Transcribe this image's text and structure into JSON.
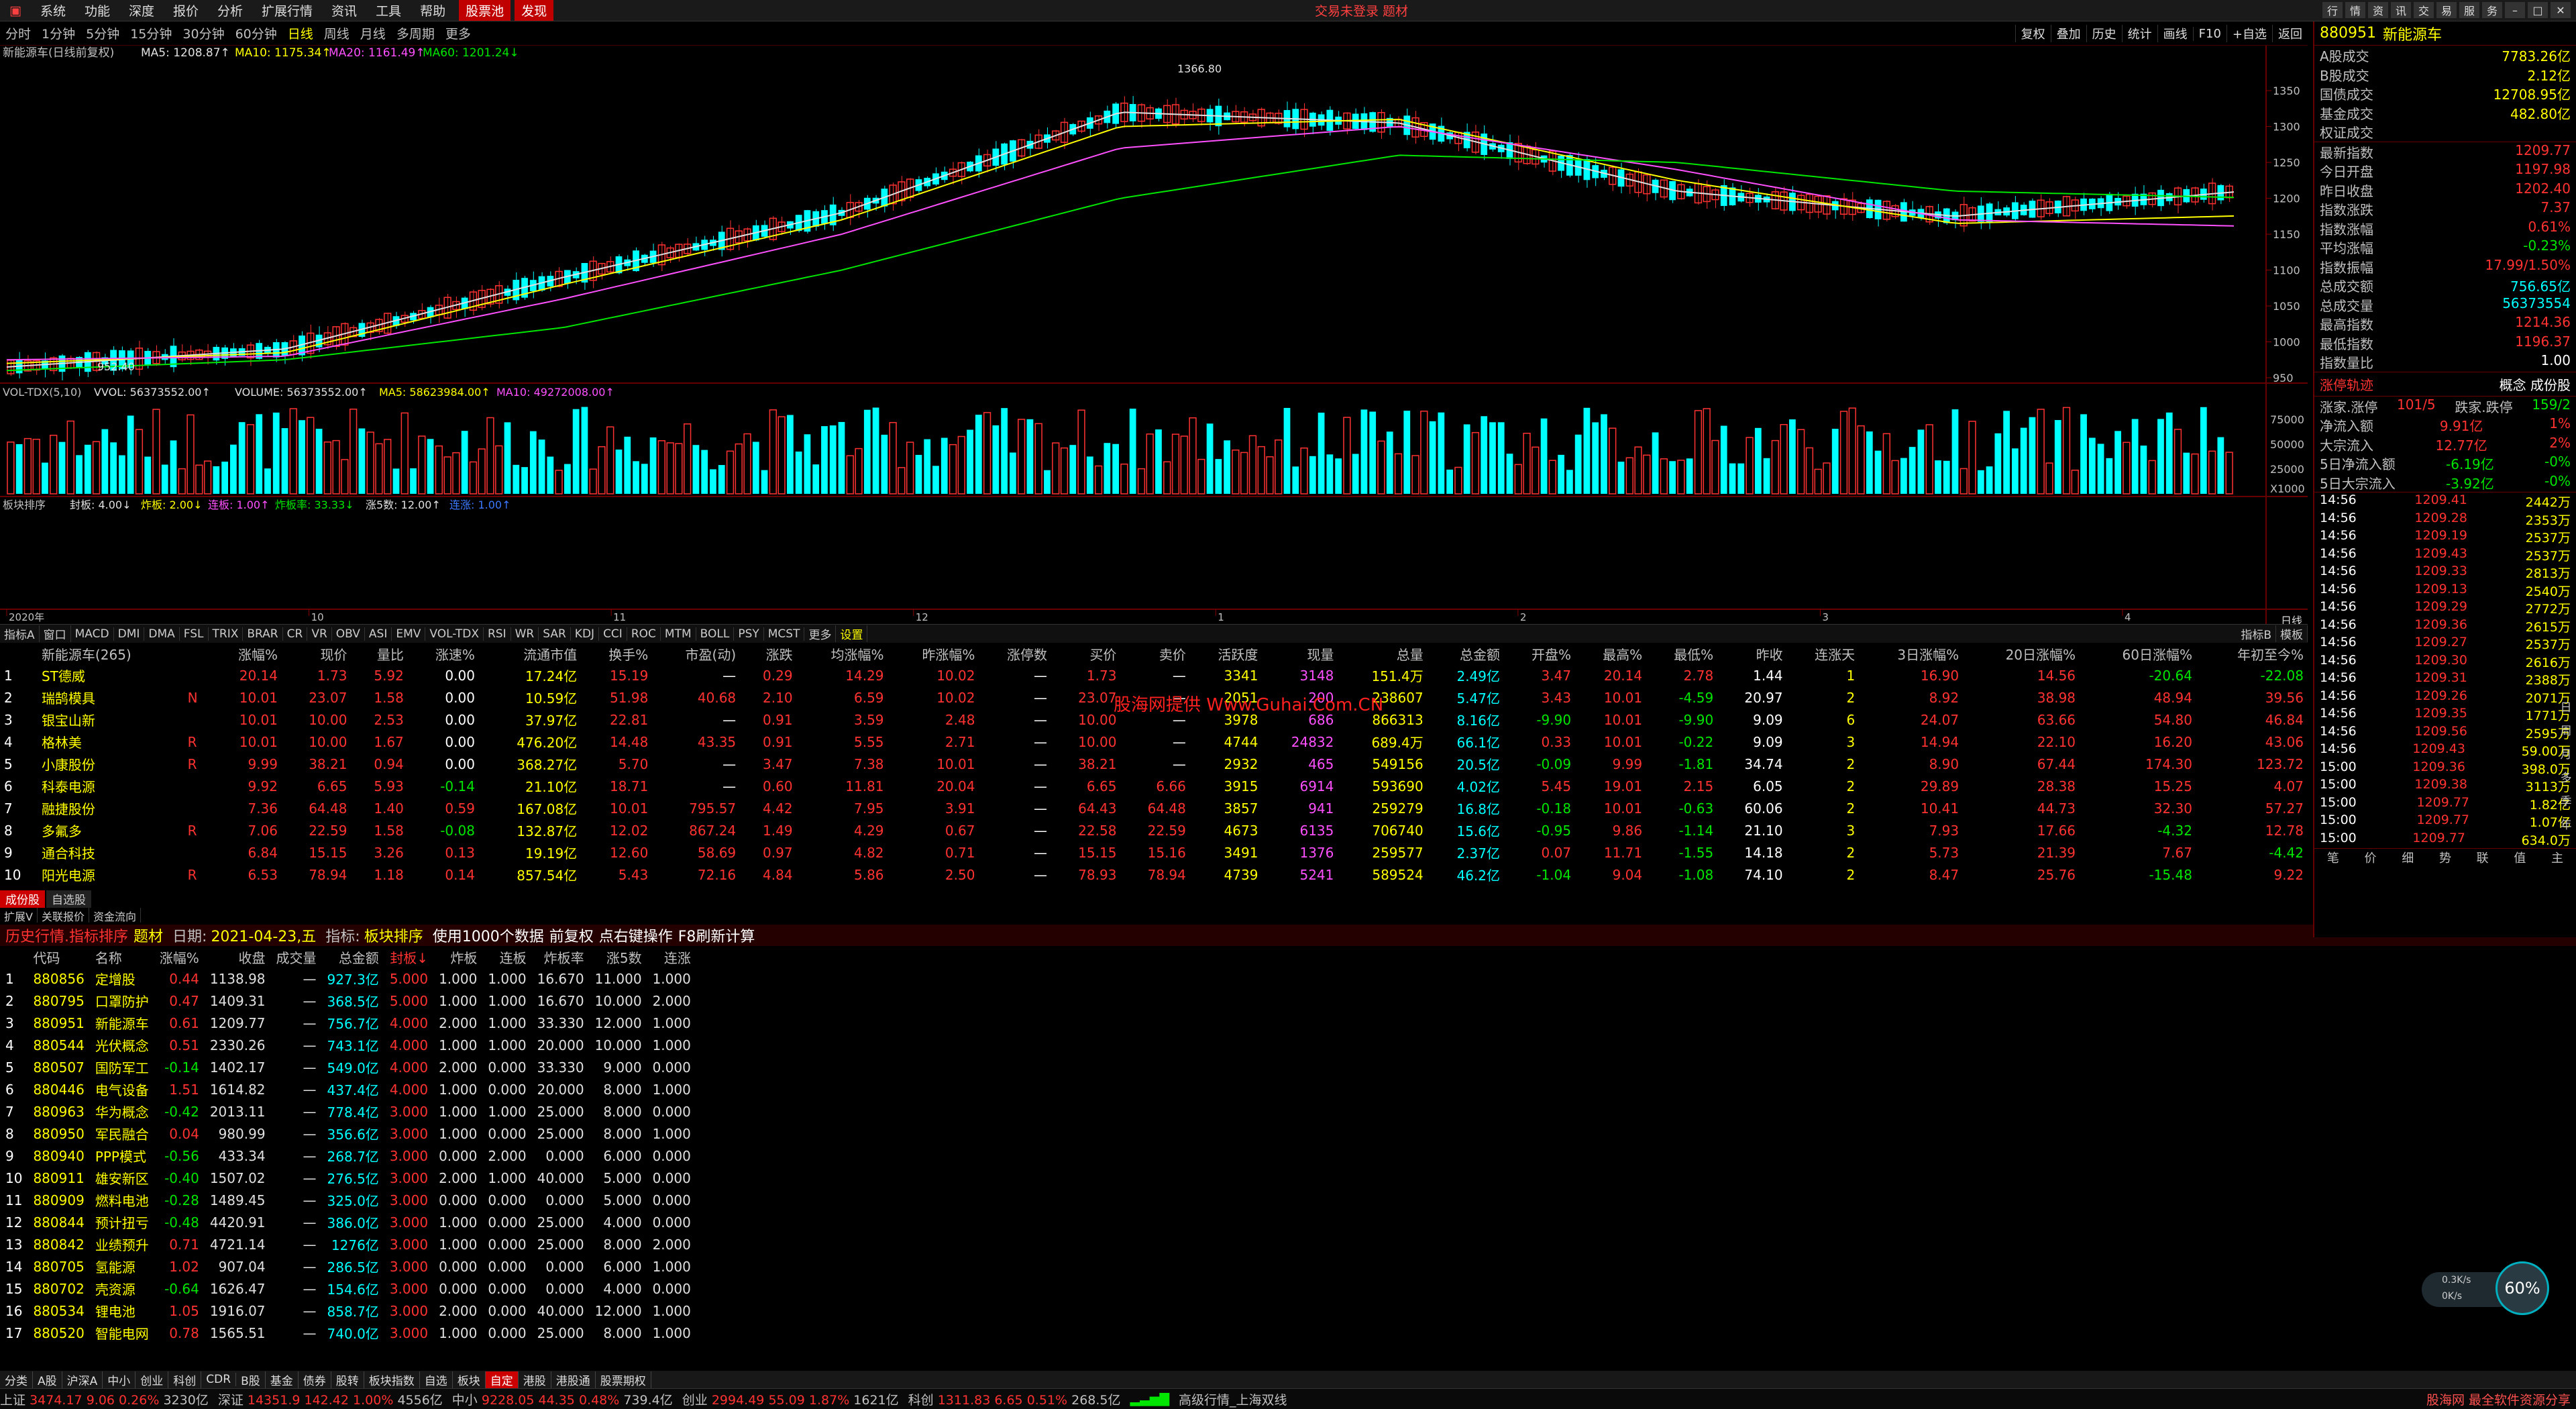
{
  "menu": {
    "items": [
      "系统",
      "功能",
      "深度",
      "报价",
      "分析",
      "扩展行情",
      "资讯",
      "工具",
      "帮助"
    ],
    "highlight": [
      "股票池",
      "发现"
    ],
    "center_title": "交易未登录  题材",
    "window_buttons": [
      "行",
      "情",
      "资",
      "讯",
      "交",
      "易",
      "服",
      "务"
    ]
  },
  "periods": [
    "分时",
    "1分钟",
    "5分钟",
    "15分钟",
    "30分钟",
    "60分钟",
    "日线",
    "周线",
    "月线",
    "多周期",
    "更多"
  ],
  "active_period": "日线",
  "chart_tools": [
    "复权",
    "叠加",
    "历史",
    "统计",
    "画线",
    "F10",
    "+自选",
    "返回"
  ],
  "main_legend": {
    "name": "新能源车(日线前复权)",
    "ma5": "MA5: 1208.87↑",
    "ma10": "MA10: 1175.34↑",
    "ma20": "MA20: 1161.49↑",
    "ma60": "MA60: 1201.24↓"
  },
  "vol_legend": {
    "name": "VOL-TDX(5,10)",
    "vvol": "VVOL: 56373552.00↑",
    "volume": "VOLUME: 56373552.00↑",
    "ma5": "MA5: 58623984.00↑",
    "ma10": "MA10: 49272008.00↑"
  },
  "board_legend": {
    "name": "板块排序",
    "fb": "封板: 4.00↓",
    "zb": "炸板: 2.00↓",
    "lb": "连板: 1.00↑",
    "zbl": "炸板率: 33.33↓",
    "z5": "涨5数: 12.00↑",
    "lz": "连涨: 1.00↑"
  },
  "price_axis": [
    "1350",
    "1300",
    "1250",
    "1200",
    "1150",
    "1100",
    "1050",
    "1000",
    "950"
  ],
  "vol_axis": [
    "75000",
    "50000",
    "25000",
    "X1000"
  ],
  "annot_high": "1366.80",
  "annot_low": "952.40",
  "date_axis": [
    "2020年",
    "10",
    "11",
    "12",
    "1",
    "2",
    "3",
    "4"
  ],
  "indicator_tabs": [
    "指标A",
    "窗口",
    "MACD",
    "DMI",
    "DMA",
    "FSL",
    "TRIX",
    "BRAR",
    "CR",
    "VR",
    "OBV",
    "ASI",
    "EMV",
    "VOL-TDX",
    "RSI",
    "WR",
    "SAR",
    "KDJ",
    "CCI",
    "ROC",
    "MTM",
    "BOLL",
    "PSY",
    "MCST",
    "更多",
    "设置"
  ],
  "indicator_right": [
    "指标B",
    "模板"
  ],
  "chart_data": {
    "type": "line",
    "title": "新能源车(日线前复权)",
    "xlabel": "",
    "ylabel": "",
    "ylim": [
      950,
      1380
    ],
    "x": [
      "2020年",
      "10",
      "11",
      "12",
      "1",
      "2",
      "3",
      "4"
    ],
    "series": [
      {
        "name": "MA5",
        "values": [
          965,
          990,
          1090,
          1180,
          1320,
          1305,
          1210,
          1175,
          1208.87
        ]
      },
      {
        "name": "MA10",
        "values": [
          970,
          985,
          1080,
          1170,
          1300,
          1310,
          1225,
          1165,
          1175.34
        ]
      },
      {
        "name": "MA20",
        "values": [
          975,
          980,
          1060,
          1150,
          1270,
          1300,
          1240,
          1170,
          1161.49
        ]
      },
      {
        "name": "MA60",
        "values": [
          960,
          975,
          1020,
          1100,
          1200,
          1260,
          1250,
          1210,
          1201.24
        ]
      }
    ]
  },
  "table1": {
    "title": "新能源车(265)",
    "columns": [
      "",
      "新能源车(265)",
      "",
      "涨幅%",
      "现价",
      "量比",
      "涨速%",
      "流通市值",
      "换手%",
      "市盈(动)",
      "涨跌",
      "均涨幅%",
      "昨涨幅%",
      "涨停数",
      "买价",
      "卖价",
      "活跃度",
      "现量",
      "总量",
      "总金额",
      "开盘%",
      "最高%",
      "最低%",
      "昨收",
      "连涨天",
      "3日涨幅%",
      "20日涨幅%",
      "60日涨幅%",
      "年初至今%"
    ],
    "rows": [
      [
        "1",
        "ST德威",
        "",
        "20.14",
        "1.73",
        "5.92",
        "0.00",
        "17.24亿",
        "15.19",
        "—",
        "0.29",
        "14.29",
        "10.02",
        "—",
        "1.73",
        "—",
        "3341",
        "3148",
        "151.4万",
        "2.49亿",
        "3.47",
        "20.14",
        "2.78",
        "1.44",
        "1",
        "16.90",
        "14.56",
        "-20.64",
        "-22.08"
      ],
      [
        "2",
        "瑞鹄模具",
        "N",
        "10.01",
        "23.07",
        "1.58",
        "0.00",
        "10.59亿",
        "51.98",
        "40.68",
        "2.10",
        "6.59",
        "10.02",
        "—",
        "23.07",
        "—",
        "2051",
        "200",
        "238607",
        "5.47亿",
        "3.43",
        "10.01",
        "-4.59",
        "20.97",
        "2",
        "8.92",
        "38.98",
        "48.94",
        "39.56"
      ],
      [
        "3",
        "银宝山新",
        "",
        "10.01",
        "10.00",
        "2.53",
        "0.00",
        "37.97亿",
        "22.81",
        "—",
        "0.91",
        "3.59",
        "2.48",
        "—",
        "10.00",
        "—",
        "3978",
        "686",
        "866313",
        "8.16亿",
        "-9.90",
        "10.01",
        "-9.90",
        "9.09",
        "6",
        "24.07",
        "63.66",
        "54.80",
        "46.84"
      ],
      [
        "4",
        "格林美",
        "R",
        "10.01",
        "10.00",
        "1.67",
        "0.00",
        "476.20亿",
        "14.48",
        "43.35",
        "0.91",
        "5.55",
        "2.71",
        "—",
        "10.00",
        "—",
        "4744",
        "24832",
        "689.4万",
        "66.1亿",
        "0.33",
        "10.01",
        "-0.22",
        "9.09",
        "3",
        "14.94",
        "22.10",
        "16.20",
        "43.06"
      ],
      [
        "5",
        "小康股份",
        "R",
        "9.99",
        "38.21",
        "0.94",
        "0.00",
        "368.27亿",
        "5.70",
        "—",
        "3.47",
        "7.38",
        "10.01",
        "—",
        "38.21",
        "—",
        "2932",
        "465",
        "549156",
        "20.5亿",
        "-0.09",
        "9.99",
        "-1.81",
        "34.74",
        "2",
        "8.90",
        "67.44",
        "174.30",
        "123.72"
      ],
      [
        "6",
        "科泰电源",
        "",
        "9.92",
        "6.65",
        "5.93",
        "-0.14",
        "21.10亿",
        "18.71",
        "—",
        "0.60",
        "11.81",
        "20.04",
        "—",
        "6.65",
        "6.66",
        "3915",
        "6914",
        "593690",
        "4.02亿",
        "5.45",
        "19.01",
        "2.15",
        "6.05",
        "2",
        "29.89",
        "28.38",
        "15.25",
        "4.07"
      ],
      [
        "7",
        "融捷股份",
        "",
        "7.36",
        "64.48",
        "1.40",
        "0.59",
        "167.08亿",
        "10.01",
        "795.57",
        "4.42",
        "7.95",
        "3.91",
        "—",
        "64.43",
        "64.48",
        "3857",
        "941",
        "259279",
        "16.8亿",
        "-0.18",
        "10.01",
        "-0.63",
        "60.06",
        "2",
        "10.41",
        "44.73",
        "32.30",
        "57.27"
      ],
      [
        "8",
        "多氟多",
        "R",
        "7.06",
        "22.59",
        "1.58",
        "-0.08",
        "132.87亿",
        "12.02",
        "867.24",
        "1.49",
        "4.29",
        "0.67",
        "—",
        "22.58",
        "22.59",
        "4673",
        "6135",
        "706740",
        "15.6亿",
        "-0.95",
        "9.86",
        "-1.14",
        "21.10",
        "3",
        "7.93",
        "17.66",
        "-4.32",
        "12.78"
      ],
      [
        "9",
        "通合科技",
        "",
        "6.84",
        "15.15",
        "3.26",
        "0.13",
        "19.19亿",
        "12.60",
        "58.69",
        "0.97",
        "4.82",
        "0.71",
        "—",
        "15.15",
        "15.16",
        "3491",
        "1376",
        "259577",
        "2.37亿",
        "0.07",
        "11.71",
        "-1.55",
        "14.18",
        "2",
        "5.73",
        "21.39",
        "7.67",
        "-4.42"
      ],
      [
        "10",
        "阳光电源",
        "R",
        "6.53",
        "78.94",
        "1.18",
        "0.14",
        "857.54亿",
        "5.43",
        "72.16",
        "4.84",
        "5.86",
        "2.50",
        "—",
        "78.93",
        "78.94",
        "4739",
        "5241",
        "589524",
        "46.2亿",
        "-1.04",
        "9.04",
        "-1.08",
        "74.10",
        "2",
        "8.47",
        "25.76",
        "-15.48",
        "9.22"
      ]
    ]
  },
  "tabs1": [
    "成份股",
    "自选股"
  ],
  "subtabs": [
    "扩展V",
    "关联报价",
    "资金流向"
  ],
  "history": {
    "title": "历史行情.指标排序",
    "label_tc": "题材",
    "date_label": "日期:",
    "date": "2021-04-23,五",
    "ind_label": "指标:",
    "ind": "板块排序",
    "count": "使用1000个数据",
    "restore": "前复权",
    "hint": "点右键操作",
    "f8": "F8刷新计算",
    "columns": [
      "",
      "代码",
      "名称",
      "涨幅%",
      "收盘",
      "成交量",
      "总金额",
      "封板↓",
      "炸板",
      "连板",
      "炸板率",
      "涨5数",
      "连涨"
    ],
    "rows": [
      [
        "1",
        "880856",
        "定增股",
        "0.44",
        "1138.98",
        "—",
        "927.3亿",
        "5.000",
        "1.000",
        "1.000",
        "16.670",
        "11.000",
        "1.000"
      ],
      [
        "2",
        "880795",
        "口罩防护",
        "0.47",
        "1409.31",
        "—",
        "368.5亿",
        "5.000",
        "1.000",
        "1.000",
        "16.670",
        "10.000",
        "2.000"
      ],
      [
        "3",
        "880951",
        "新能源车",
        "0.61",
        "1209.77",
        "—",
        "756.7亿",
        "4.000",
        "2.000",
        "1.000",
        "33.330",
        "12.000",
        "1.000"
      ],
      [
        "4",
        "880544",
        "光伏概念",
        "0.51",
        "2330.26",
        "—",
        "743.1亿",
        "4.000",
        "1.000",
        "1.000",
        "20.000",
        "10.000",
        "1.000"
      ],
      [
        "5",
        "880507",
        "国防军工",
        "-0.14",
        "1402.17",
        "—",
        "549.0亿",
        "4.000",
        "2.000",
        "0.000",
        "33.330",
        "9.000",
        "0.000"
      ],
      [
        "6",
        "880446",
        "电气设备",
        "1.51",
        "1614.82",
        "—",
        "437.4亿",
        "4.000",
        "1.000",
        "0.000",
        "20.000",
        "8.000",
        "1.000"
      ],
      [
        "7",
        "880963",
        "华为概念",
        "-0.42",
        "2013.11",
        "—",
        "778.4亿",
        "3.000",
        "1.000",
        "1.000",
        "25.000",
        "8.000",
        "0.000"
      ],
      [
        "8",
        "880950",
        "军民融合",
        "0.04",
        "980.99",
        "—",
        "356.6亿",
        "3.000",
        "1.000",
        "0.000",
        "25.000",
        "8.000",
        "1.000"
      ],
      [
        "9",
        "880940",
        "PPP模式",
        "-0.56",
        "433.34",
        "—",
        "268.7亿",
        "3.000",
        "0.000",
        "2.000",
        "0.000",
        "6.000",
        "0.000"
      ],
      [
        "10",
        "880911",
        "雄安新区",
        "-0.40",
        "1507.02",
        "—",
        "276.5亿",
        "3.000",
        "2.000",
        "1.000",
        "40.000",
        "5.000",
        "0.000"
      ],
      [
        "11",
        "880909",
        "燃料电池",
        "-0.28",
        "1489.45",
        "—",
        "325.0亿",
        "3.000",
        "0.000",
        "0.000",
        "0.000",
        "5.000",
        "0.000"
      ],
      [
        "12",
        "880844",
        "预计扭亏",
        "-0.48",
        "4420.91",
        "—",
        "386.0亿",
        "3.000",
        "1.000",
        "0.000",
        "25.000",
        "4.000",
        "0.000"
      ],
      [
        "13",
        "880842",
        "业绩预升",
        "0.71",
        "4721.14",
        "—",
        "1276亿",
        "3.000",
        "1.000",
        "0.000",
        "25.000",
        "8.000",
        "2.000"
      ],
      [
        "14",
        "880705",
        "氢能源",
        "1.02",
        "907.04",
        "—",
        "286.5亿",
        "3.000",
        "0.000",
        "0.000",
        "0.000",
        "6.000",
        "1.000"
      ],
      [
        "15",
        "880702",
        "壳资源",
        "-0.64",
        "1626.47",
        "—",
        "154.6亿",
        "3.000",
        "0.000",
        "0.000",
        "0.000",
        "4.000",
        "0.000"
      ],
      [
        "16",
        "880534",
        "锂电池",
        "1.05",
        "1916.07",
        "—",
        "858.7亿",
        "3.000",
        "2.000",
        "0.000",
        "40.000",
        "12.000",
        "1.000"
      ],
      [
        "17",
        "880520",
        "智能电网",
        "0.78",
        "1565.51",
        "—",
        "740.0亿",
        "3.000",
        "1.000",
        "0.000",
        "25.000",
        "8.000",
        "1.000"
      ]
    ]
  },
  "right_panel": {
    "code": "880951",
    "name": "新能源车",
    "rows1": [
      [
        "A股成交",
        "7783.26亿"
      ],
      [
        "B股成交",
        "2.12亿"
      ],
      [
        "国债成交",
        "12708.95亿"
      ],
      [
        "基金成交",
        "482.80亿"
      ],
      [
        "权证成交",
        ""
      ]
    ],
    "rows2": [
      [
        "最新指数",
        "1209.77"
      ],
      [
        "今日开盘",
        "1197.98"
      ],
      [
        "昨日收盘",
        "1202.40"
      ],
      [
        "指数涨跌",
        "7.37"
      ],
      [
        "指数涨幅",
        "0.61%"
      ],
      [
        "平均涨幅",
        "-0.23%"
      ],
      [
        "指数振幅",
        "17.99/1.50%"
      ],
      [
        "总成交额",
        "756.65亿"
      ],
      [
        "总成交量",
        "56373554"
      ],
      [
        "最高指数",
        "1214.36"
      ],
      [
        "最低指数",
        "1196.37"
      ],
      [
        "指数量比",
        "1.00"
      ]
    ],
    "zt_title": "涨停轨迹",
    "zt_tag": "概念 成份股",
    "zt_row": [
      "涨家.涨停",
      "101/5",
      "跌家.跌停",
      "159/2"
    ],
    "flows": [
      [
        "净流入额",
        "9.91亿",
        "1%"
      ],
      [
        "大宗流入",
        "12.77亿",
        "2%"
      ],
      [
        "5日净流入额",
        "-6.19亿",
        "-0%"
      ],
      [
        "5日大宗流入",
        "-3.92亿",
        "-0%"
      ]
    ],
    "ticks": [
      [
        "14:56",
        "1209.41",
        "2442万"
      ],
      [
        "14:56",
        "1209.28",
        "2353万"
      ],
      [
        "14:56",
        "1209.19",
        "2537万"
      ],
      [
        "14:56",
        "1209.43",
        "2537万"
      ],
      [
        "14:56",
        "1209.33",
        "2813万"
      ],
      [
        "14:56",
        "1209.13",
        "2540万"
      ],
      [
        "14:56",
        "1209.29",
        "2772万"
      ],
      [
        "14:56",
        "1209.36",
        "2615万"
      ],
      [
        "14:56",
        "1209.27",
        "2537万"
      ],
      [
        "14:56",
        "1209.30",
        "2616万"
      ],
      [
        "14:56",
        "1209.31",
        "2388万"
      ],
      [
        "14:56",
        "1209.26",
        "2071万"
      ],
      [
        "14:56",
        "1209.35",
        "1771万"
      ],
      [
        "14:56",
        "1209.56",
        "2595万"
      ],
      [
        "14:56",
        "1209.43",
        "59.00万"
      ],
      [
        "15:00",
        "1209.36",
        "398.0万"
      ],
      [
        "15:00",
        "1209.38",
        "3113万"
      ],
      [
        "15:00",
        "1209.77",
        "1.82亿"
      ],
      [
        "15:00",
        "1209.77",
        "1.07亿"
      ],
      [
        "15:00",
        "1209.77",
        "634.0万"
      ]
    ],
    "bottom_tabs": [
      "笔",
      "价",
      "细",
      "势",
      "联",
      "值",
      "主"
    ],
    "side_tabs": [
      "日",
      "周",
      "月",
      "多",
      "季",
      "年"
    ]
  },
  "bottom_tabs": [
    "分类",
    "A股",
    "沪深A",
    "中小",
    "创业",
    "科创",
    "CDR",
    "B股",
    "基金",
    "债券",
    "股转",
    "板块指数",
    "自选",
    "板块",
    "自定",
    "港股",
    "港股通",
    "股票期权"
  ],
  "active_bottom_tab": "自定",
  "status": {
    "sh": "上证",
    "sh_v": "3474.17",
    "sh_c": "9.06",
    "sh_p": "0.26%",
    "sh_a": "3230亿",
    "sz": "深证",
    "sz_v": "14351.9",
    "sz_c": "142.42",
    "sz_p": "1.00%",
    "sz_a": "4556亿",
    "zx": "中小",
    "zx_v": "9228.05",
    "zx_c": "44.35",
    "zx_p": "0.48%",
    "zx_a": "739.4亿",
    "cy": "创业",
    "cy_v": "2994.49",
    "cy_c": "55.09",
    "cy_p": "1.87%",
    "cy_a": "1621亿",
    "kc": "科创",
    "kc_v": "1311.83",
    "kc_c": "6.65",
    "kc_p": "0.51%",
    "kc_a": "268.5亿",
    "server": "高级行情_上海双线",
    "brand": "股海网 最全软件资源分享"
  },
  "watermark": "股海网提供 Www.Guhai.Com.CN",
  "gauge": {
    "up": "0.3K/s",
    "down": "0K/s",
    "pct": "60%"
  }
}
